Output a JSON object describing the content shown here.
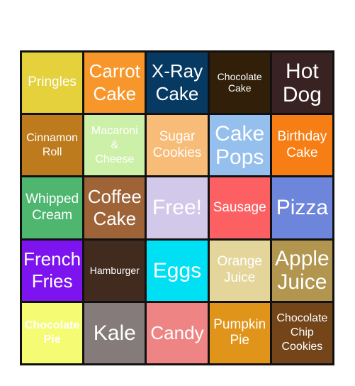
{
  "card": {
    "cells": [
      {
        "label": "Pringles",
        "bg": "#e4d13b",
        "size": "md"
      },
      {
        "label": "Carrot\nCake",
        "bg": "#f7962a",
        "size": "lg"
      },
      {
        "label": "X-Ray\nCake",
        "bg": "#063a63",
        "size": "lg"
      },
      {
        "label": "Chocolate\nCake",
        "bg": "#311f09",
        "size": "xs"
      },
      {
        "label": "Hot\nDog",
        "bg": "#392322",
        "size": "xl"
      },
      {
        "label": "Cinnamon\nRoll",
        "bg": "#be7b1d",
        "size": "sm"
      },
      {
        "label": "Macaroni\n&\nCheese",
        "bg": "#cdf0a9",
        "size": "sm"
      },
      {
        "label": "Sugar\nCookies",
        "bg": "#f8bc79",
        "size": "md"
      },
      {
        "label": "Cake\nPops",
        "bg": "#95bfed",
        "size": "xl"
      },
      {
        "label": "Birthday\nCake",
        "bg": "#f67e15",
        "size": "md"
      },
      {
        "label": "Whipped\nCream",
        "bg": "#4fb66f",
        "size": "md"
      },
      {
        "label": "Coffee\nCake",
        "bg": "#9e6437",
        "size": "lg"
      },
      {
        "label": "Free!",
        "bg": "#d2c8ea",
        "size": "xl"
      },
      {
        "label": "Sausage",
        "bg": "#fd6063",
        "size": "md"
      },
      {
        "label": "Pizza",
        "bg": "#6e85dc",
        "size": "xl"
      },
      {
        "label": "French\nFries",
        "bg": "#7d14ef",
        "size": "lg"
      },
      {
        "label": "Hamburger",
        "bg": "#412a1e",
        "size": "xs"
      },
      {
        "label": "Eggs",
        "bg": "#00e0f5",
        "size": "xl"
      },
      {
        "label": "Orange\nJuice",
        "bg": "#e4d69b",
        "size": "md"
      },
      {
        "label": "Apple\nJuice",
        "bg": "#b2954e",
        "size": "xl"
      },
      {
        "label": "Chocolate\nPie",
        "bg": "#f6fb74",
        "size": "sm",
        "bold": true
      },
      {
        "label": "Kale",
        "bg": "#857b7b",
        "size": "xl"
      },
      {
        "label": "Candy",
        "bg": "#ee8484",
        "size": "lg"
      },
      {
        "label": "Pumpkin\nPie",
        "bg": "#e1941a",
        "size": "md"
      },
      {
        "label": "Chocolate\nChip\nCookies",
        "bg": "#734519",
        "size": "sm"
      }
    ]
  }
}
